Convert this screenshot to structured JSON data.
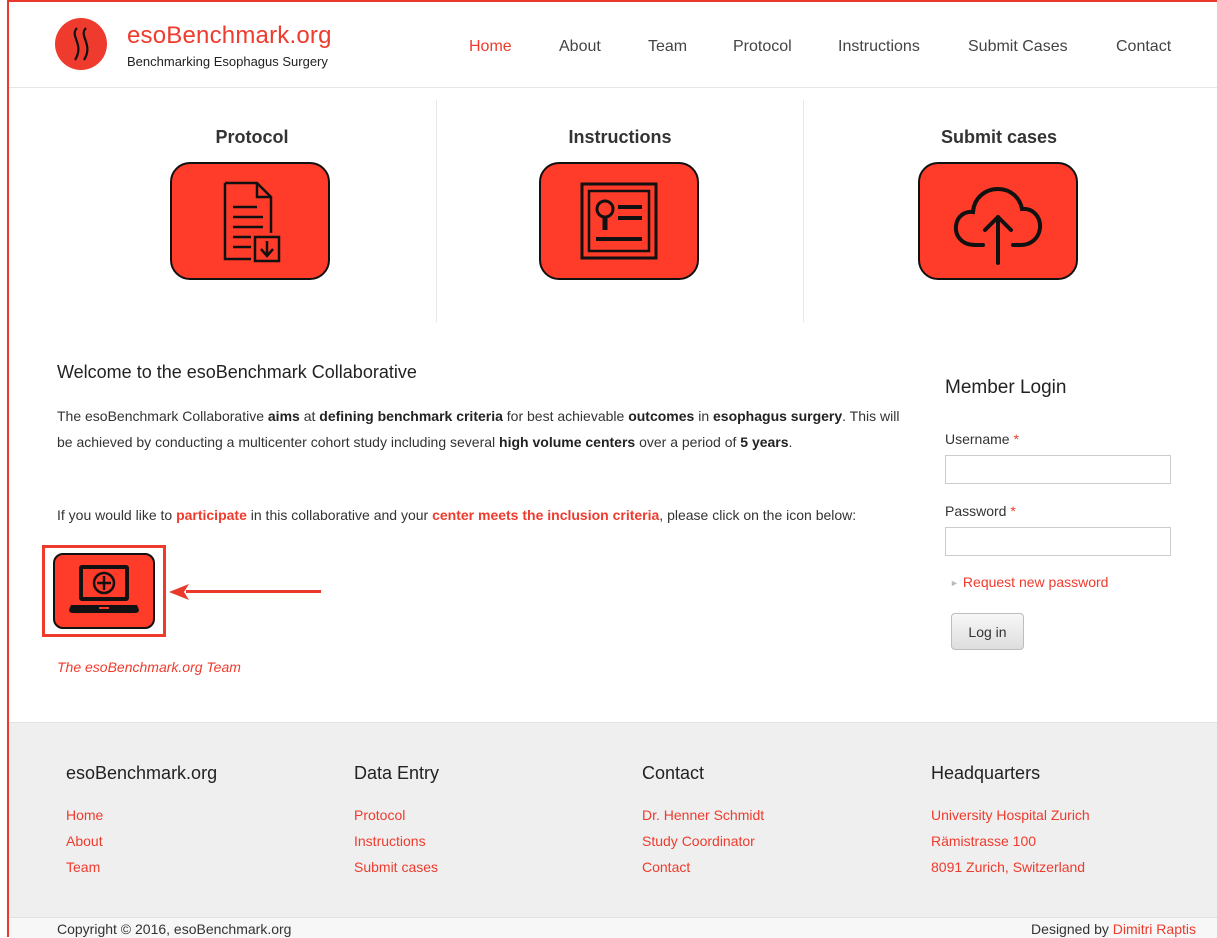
{
  "brand": {
    "title": "esoBenchmark.org",
    "subtitle": "Benchmarking Esophagus Surgery",
    "accent_color": "#ef3b2d"
  },
  "nav": {
    "items": [
      {
        "label": "Home",
        "active": true
      },
      {
        "label": "About"
      },
      {
        "label": "Team"
      },
      {
        "label": "Protocol"
      },
      {
        "label": "Instructions"
      },
      {
        "label": "Submit Cases"
      },
      {
        "label": "Contact"
      }
    ]
  },
  "features": [
    {
      "title": "Protocol",
      "icon": "document-download-icon"
    },
    {
      "title": "Instructions",
      "icon": "instructions-card-icon"
    },
    {
      "title": "Submit cases",
      "icon": "cloud-upload-icon"
    }
  ],
  "welcome": {
    "title": "Welcome to the esoBenchmark Collaborative",
    "p1": {
      "t1": "The esoBenchmark Collaborative ",
      "b1": "aims",
      "t2": " at ",
      "b2": "defining benchmark criteria",
      "t3": " for best achievable ",
      "b3": "outcomes",
      "t4": " in ",
      "b4": "esophagus surgery",
      "t5": ". This will be achieved by conducting a multicenter cohort study including several ",
      "b5": "high volume centers",
      "t6": " over a period of ",
      "b6": "5 years",
      "t7": "."
    },
    "p2": {
      "t1": "If you would like to ",
      "r1": "participate",
      "t2": " in this collaborative and your ",
      "r2": "center meets the inclusion criteria",
      "t3": ", please click on the icon below:"
    },
    "signup_icon": "laptop-plus-icon",
    "signature": "The esoBenchmark.org Team"
  },
  "login": {
    "title": "Member Login",
    "username_label": "Username",
    "password_label": "Password",
    "required_mark": "*",
    "username_value": "",
    "password_value": "",
    "request_password": "Request new password",
    "submit": "Log in"
  },
  "footer": {
    "columns": [
      {
        "title": "esoBenchmark.org",
        "links": [
          "Home",
          "About",
          "Team"
        ]
      },
      {
        "title": "Data Entry",
        "links": [
          "Protocol",
          "Instructions",
          "Submit cases"
        ]
      },
      {
        "title": "Contact",
        "links": [
          "Dr. Henner Schmidt",
          "Study Coordinator",
          "Contact"
        ]
      },
      {
        "title": "Headquarters",
        "links": [
          "University Hospital Zurich",
          "Rämistrasse 100",
          "8091 Zurich, Switzerland"
        ]
      }
    ],
    "copyright": "Copyright © 2016, esoBenchmark.org",
    "designed_by_prefix": "Designed by ",
    "designer": "Dimitri Raptis"
  }
}
